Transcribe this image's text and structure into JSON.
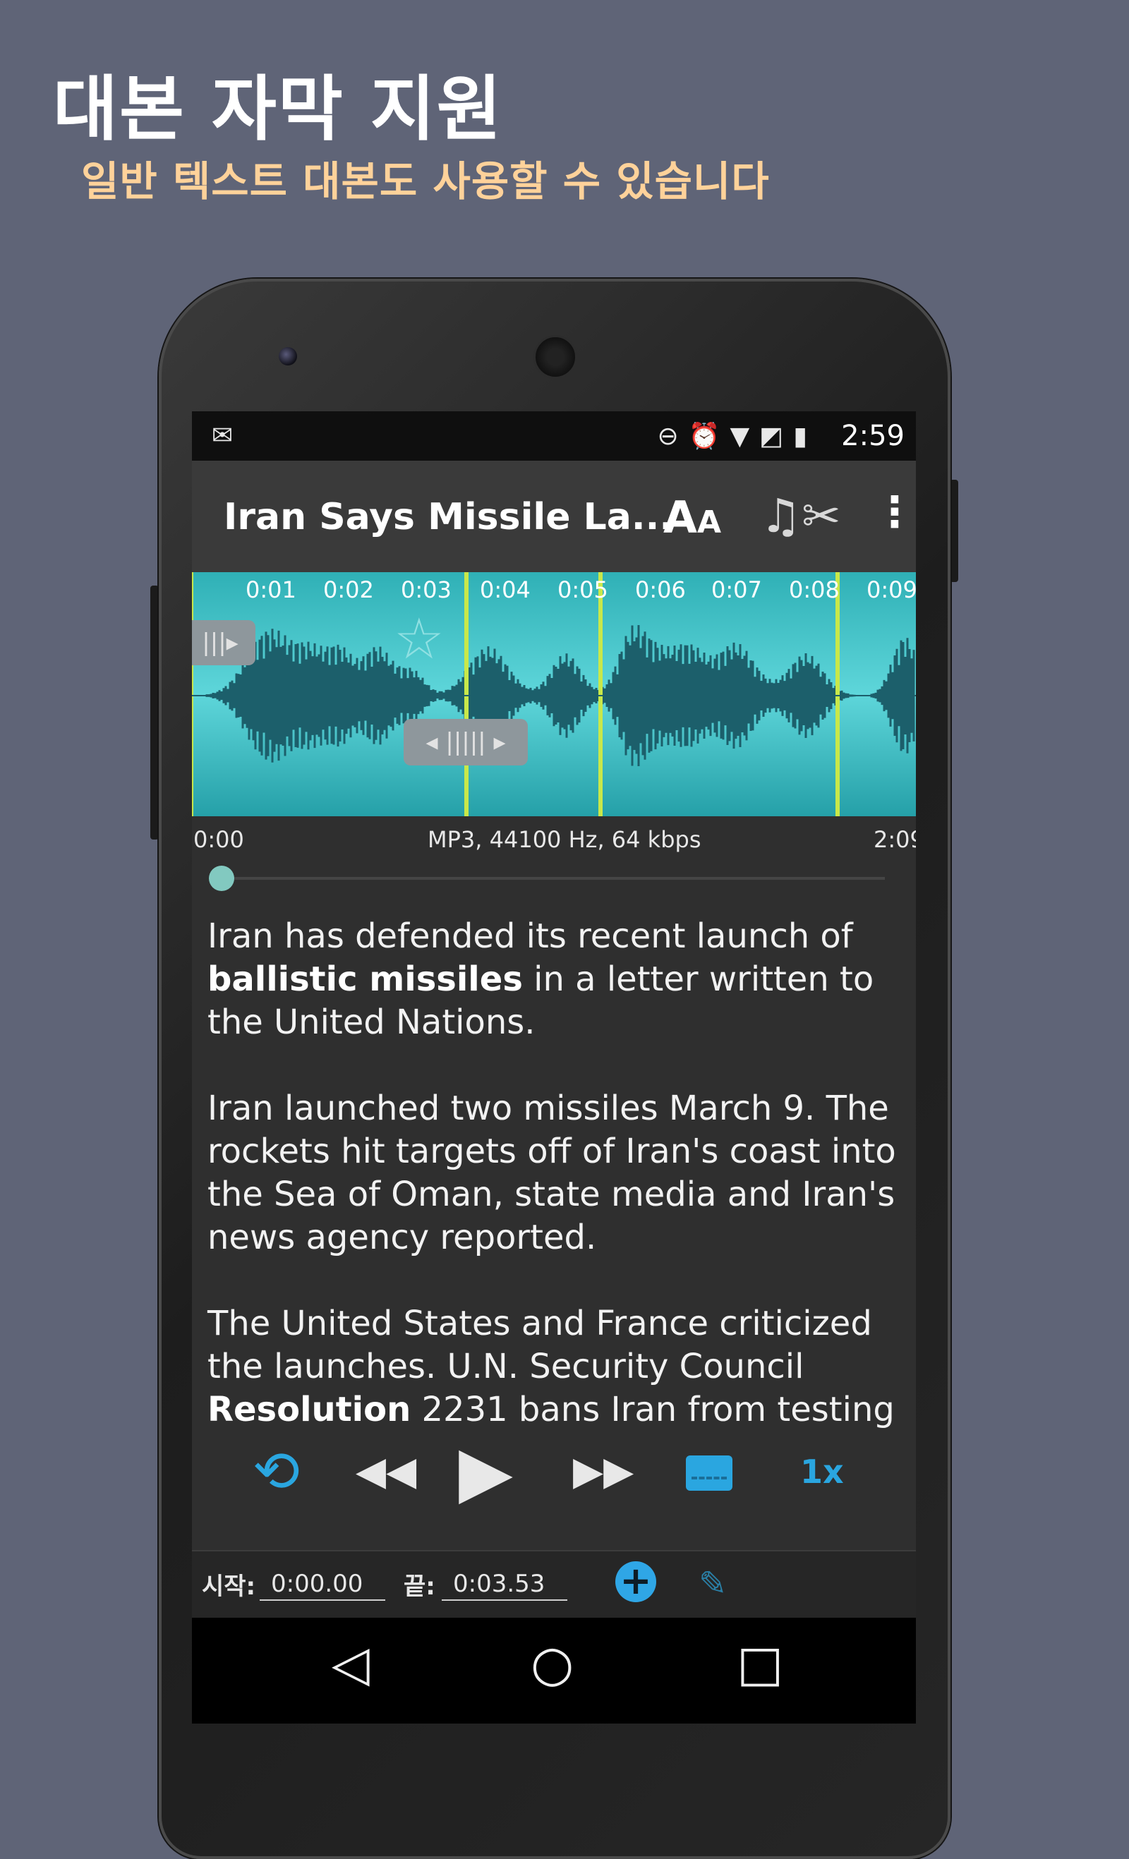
{
  "promo": {
    "headline": "대본 자막 지원",
    "subline": "일반 텍스트 대본도 사용할 수 있습니다"
  },
  "status_bar": {
    "left_icon": "inbox-icon",
    "icons": [
      "dnd-icon",
      "alarm-icon",
      "wifi-icon",
      "no-sim-icon",
      "battery-charging-icon"
    ],
    "time": "2:59"
  },
  "toolbar": {
    "title": "Iran Says Missile La...",
    "font_size_label": "AA",
    "actions": [
      "font-size-icon",
      "music-scissors-icon",
      "more-vert-icon"
    ]
  },
  "waveform": {
    "ticks": [
      "0:01",
      "0:02",
      "0:03",
      "0:04",
      "0:05",
      "0:06",
      "0:07",
      "0:08",
      "0:09"
    ],
    "colors": {
      "background": "#4fc9cf",
      "wave": "#1c5f6b",
      "marker": "#c8e84a"
    }
  },
  "file_info": {
    "start": "0:00",
    "format": "MP3, 44100 Hz, 64 kbps",
    "end": "2:09"
  },
  "transcript": {
    "p1_a": "Iran has defended its recent launch of",
    "p1_bold": "ballistic missiles",
    "p1_b": " in a letter written to the United Nations.",
    "p2": "Iran launched two missiles March 9. The rockets hit targets off of Iran's coast into the Sea of Oman, state media and Iran's news agency reported.",
    "p3_a": "The United States and France criticized the launches. U.N. Security Council ",
    "p3_bold": "Resolution",
    "p3_b": " 2231 bans Iran from testing"
  },
  "controls": {
    "repeat": "⟲",
    "rewind": "◀◀",
    "play": "▶",
    "fast_forward": "▶▶",
    "speed": "1x",
    "accent": "#2aa6e0"
  },
  "edit": {
    "start_label": "시작:",
    "start_value": "0:00.00",
    "end_label": "끝:",
    "end_value": "0:03.53",
    "add": "+",
    "pen": "✎"
  },
  "nav": {
    "back": "◁",
    "home": "○",
    "recents": "□"
  }
}
